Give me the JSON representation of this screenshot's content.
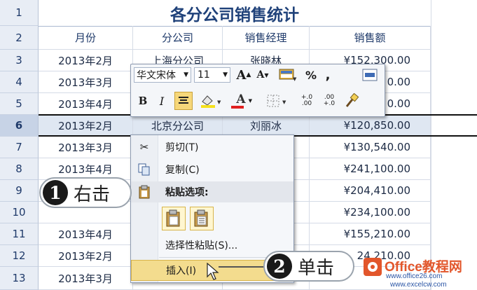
{
  "sheet": {
    "row_numbers": [
      "1",
      "2",
      "3",
      "4",
      "5",
      "6",
      "7",
      "8",
      "9",
      "10",
      "11",
      "12",
      "13"
    ],
    "title": "各分公司销售统计",
    "headers": [
      "月份",
      "分公司",
      "销售经理",
      "销售额"
    ],
    "rows": [
      {
        "month": "2013年2月",
        "company": "上海分公司",
        "manager": "张晓林",
        "amount": "¥152,300.00"
      },
      {
        "month": "2013年3月",
        "company": "",
        "manager": "",
        "amount": "0.00"
      },
      {
        "month": "2013年4月",
        "company": "",
        "manager": "",
        "amount": "0.00"
      },
      {
        "month": "2013年2月",
        "company": "北京分公司",
        "manager": "刘丽冰",
        "amount": "¥120,850.00"
      },
      {
        "month": "2013年3月",
        "company": "",
        "manager": "",
        "amount": "¥130,540.00"
      },
      {
        "month": "2013年4月",
        "company": "",
        "manager": "",
        "amount": "¥241,100.00"
      },
      {
        "month": "",
        "company": "",
        "manager": "",
        "amount": "¥204,410.00"
      },
      {
        "month": "",
        "company": "",
        "manager": "",
        "amount": "¥234,100.00"
      },
      {
        "month": "2013年4月",
        "company": "",
        "manager": "",
        "amount": "¥155,210.00"
      },
      {
        "month": "2013年2月",
        "company": "",
        "manager": "",
        "amount": "24,210.00"
      },
      {
        "month": "2013年3月",
        "company": "",
        "manager": "",
        "amount": ""
      }
    ]
  },
  "mini_toolbar": {
    "font_name": "华文宋体",
    "font_size": "11",
    "grow_font": "A",
    "shrink_font": "A",
    "percent": "%",
    "comma": ",",
    "bold": "B",
    "italic": "I",
    "font_color_letter": "A",
    "inc_decimal": "+.0 .00",
    "dec_decimal": ".00 +.0"
  },
  "context_menu": {
    "cut": "剪切(T)",
    "copy": "复制(C)",
    "paste_options": "粘贴选项:",
    "paste_special": "选择性粘贴(S)...",
    "insert": "插入(I)"
  },
  "callouts": {
    "step1_num": "1",
    "step1_text": "右击",
    "step2_num": "2",
    "step2_text": "单击"
  },
  "watermark": {
    "brand": "Office教程网",
    "url": "www.office26.com",
    "sub": "www.excelcw.com"
  },
  "colors": {
    "title": "#20427a",
    "selected_row": "#dfe7f2",
    "menu_highlight": "#f3dc8e"
  }
}
